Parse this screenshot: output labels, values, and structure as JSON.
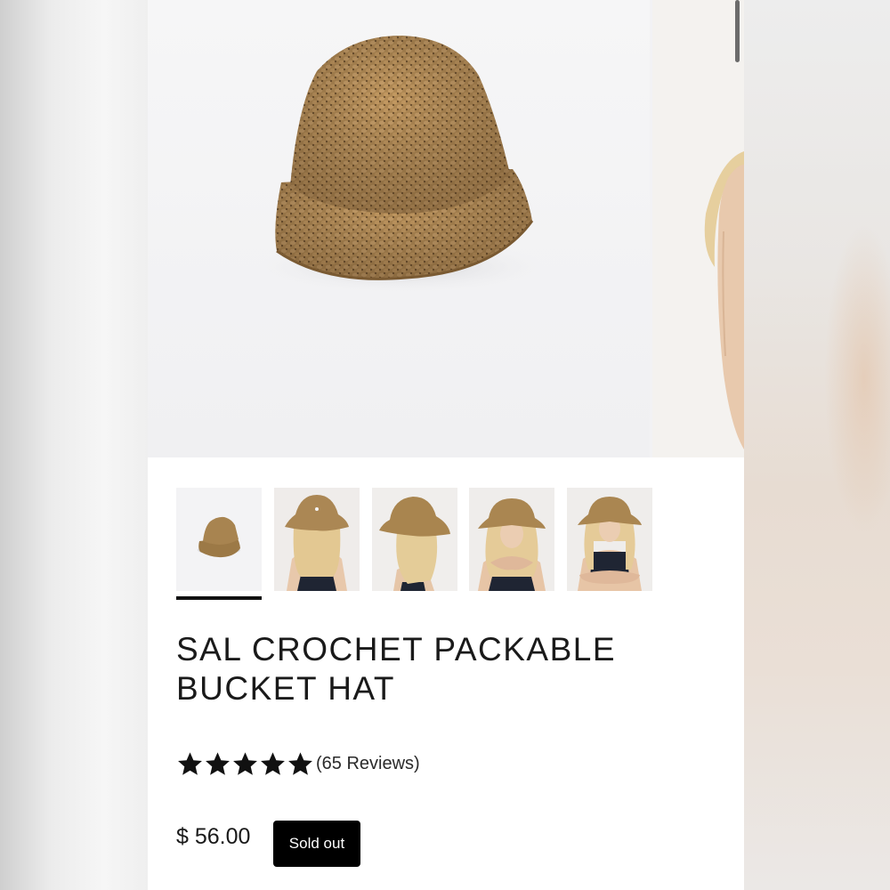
{
  "product": {
    "title_line1": "SAL CROCHET PACKABLE",
    "title_line2": "BUCKET HAT",
    "rating": 5,
    "rating_max": 5,
    "reviews_label": "(65 Reviews)",
    "price": "$ 56.00",
    "sold_out_label": "Sold out"
  },
  "gallery": {
    "selected_index": 0,
    "thumbnails": [
      {
        "name": "hat-product-shot"
      },
      {
        "name": "model-back-view"
      },
      {
        "name": "model-side-view"
      },
      {
        "name": "model-front-arms-crossed"
      },
      {
        "name": "model-front-arms-folded"
      }
    ]
  },
  "colors": {
    "straw": "#b08a55",
    "straw_dark": "#8a6a3c",
    "text": "#1a1a1a",
    "button_bg": "#000000"
  }
}
